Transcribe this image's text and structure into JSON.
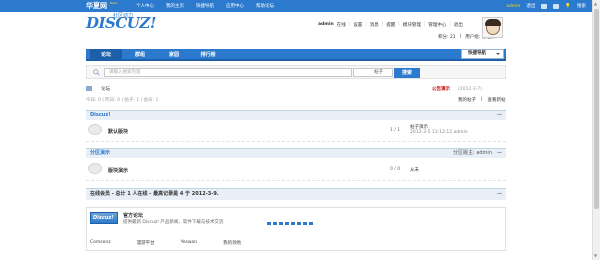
{
  "topbar": {
    "brand": "华夏网",
    "beta": "Beta",
    "nav": [
      "个人中心",
      "我的主页",
      "快捷导航",
      "应用中心",
      "帮助论坛"
    ],
    "user": "admin",
    "logout": "退出",
    "search": "搜索"
  },
  "logo": {
    "main": "DISCUZ!",
    "sub": "社区动力"
  },
  "userbar": {
    "name": "admin",
    "status": "在线",
    "items": [
      "设置",
      "消息",
      "提醒",
      "模块管理",
      "管理中心",
      "退出"
    ],
    "credits": "积分: 21",
    "group": "用户组: 管理员"
  },
  "nav": {
    "tabs": [
      "论坛",
      "群组",
      "家园",
      "排行榜"
    ],
    "quick": "快捷导航"
  },
  "search": {
    "placeholder": "请输入搜索内容",
    "type": "帖子",
    "button": "搜索"
  },
  "crumb": {
    "text": "论坛",
    "notice_title": "公告演示",
    "notice_date": "(2012-3-7)"
  },
  "stats": {
    "text": "今日: 0 | 昨日: 0 | 帖子: 1 | 会员: 1",
    "links": [
      "我的帖子",
      "查看新帖"
    ]
  },
  "categories": [
    {
      "title": "Discuz!",
      "moderator": "",
      "forums": [
        {
          "name": "默认版块",
          "counts": "1 / 1",
          "last_title": "帖子演示",
          "last_meta": "2012-3-5 13:12:12 admin"
        }
      ]
    },
    {
      "title": "分区演示",
      "moderator": "分区版主: admin",
      "forums": [
        {
          "name": "版块演示",
          "counts": "0 / 0",
          "last_title": "从未",
          "last_meta": ""
        }
      ]
    }
  ],
  "online": {
    "text": "在线会员 - 总计 1 人在线 - 最高记录是 4 于 2012-3-9."
  },
  "links_box": {
    "logo_text": "Discuz!",
    "title": "官方论坛",
    "desc": "提供最新 Discuz! 产品新闻、软件下载与技术交流",
    "progress_segments": 8,
    "links": [
      "Comsenz",
      "漫游平台",
      "Yeswan",
      "我的领地"
    ]
  },
  "colors": {
    "primary": "#2b7acd",
    "accent": "#ffd800"
  }
}
